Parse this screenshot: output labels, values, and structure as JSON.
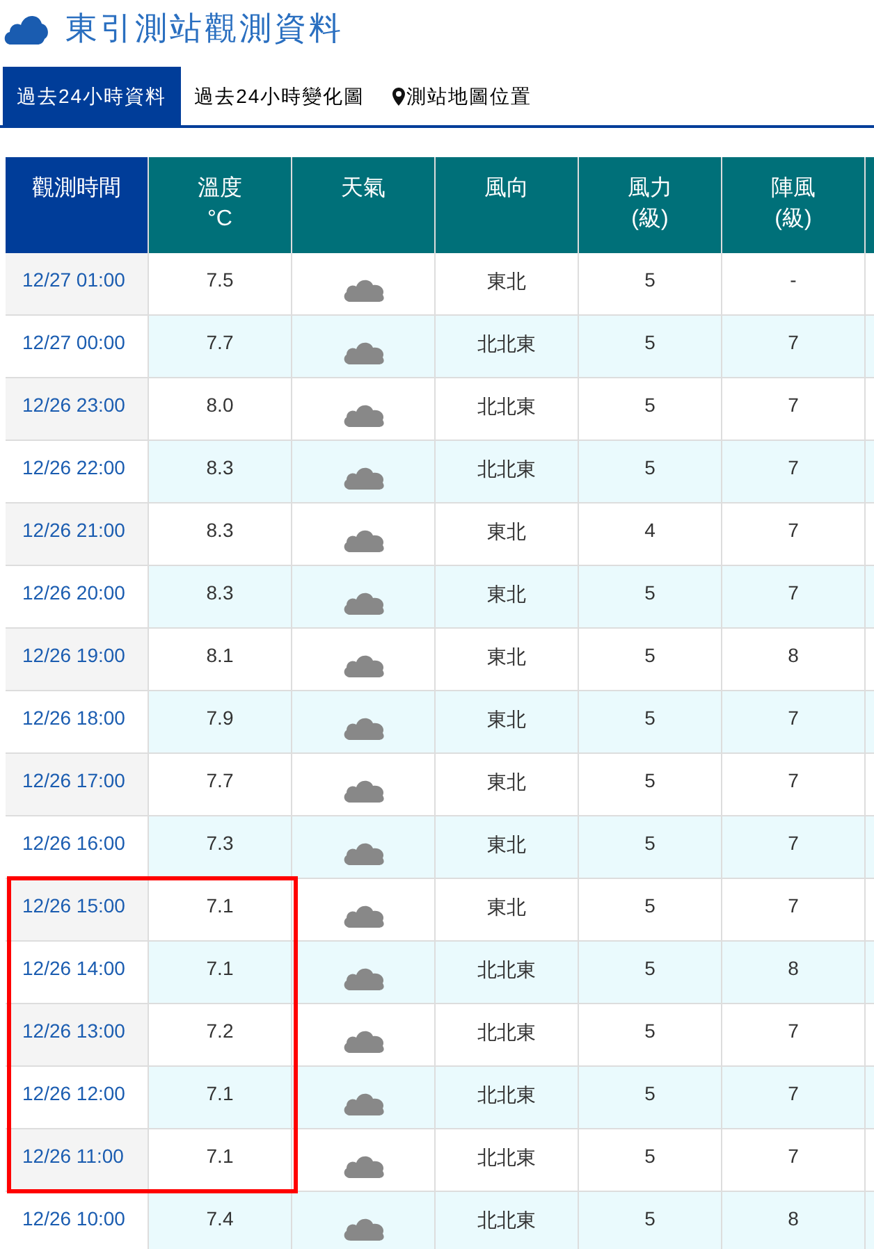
{
  "title": "東引測站觀測資料",
  "tabs": [
    {
      "label": "過去24小時資料",
      "selected": true,
      "kind": "plain"
    },
    {
      "label": "過去24小時變化圖",
      "selected": false,
      "kind": "plain"
    },
    {
      "label": "測站地圖位置",
      "selected": false,
      "kind": "map"
    }
  ],
  "table": {
    "columns": [
      [
        "觀測時間"
      ],
      [
        "溫度",
        "°C"
      ],
      [
        "天氣"
      ],
      [
        "風向"
      ],
      [
        "風力",
        "(級)"
      ],
      [
        "陣風",
        "(級)"
      ]
    ],
    "rows": [
      {
        "time": "12/27 01:00",
        "temp": "7.5",
        "dir": "東北",
        "force": "5",
        "gust": "-",
        "highlighted": false
      },
      {
        "time": "12/27 00:00",
        "temp": "7.7",
        "dir": "北北東",
        "force": "5",
        "gust": "7",
        "highlighted": false
      },
      {
        "time": "12/26 23:00",
        "temp": "8.0",
        "dir": "北北東",
        "force": "5",
        "gust": "7",
        "highlighted": false
      },
      {
        "time": "12/26 22:00",
        "temp": "8.3",
        "dir": "北北東",
        "force": "5",
        "gust": "7",
        "highlighted": false
      },
      {
        "time": "12/26 21:00",
        "temp": "8.3",
        "dir": "東北",
        "force": "4",
        "gust": "7",
        "highlighted": false
      },
      {
        "time": "12/26 20:00",
        "temp": "8.3",
        "dir": "東北",
        "force": "5",
        "gust": "7",
        "highlighted": false
      },
      {
        "time": "12/26 19:00",
        "temp": "8.1",
        "dir": "東北",
        "force": "5",
        "gust": "8",
        "highlighted": false
      },
      {
        "time": "12/26 18:00",
        "temp": "7.9",
        "dir": "東北",
        "force": "5",
        "gust": "7",
        "highlighted": false
      },
      {
        "time": "12/26 17:00",
        "temp": "7.7",
        "dir": "東北",
        "force": "5",
        "gust": "7",
        "highlighted": false
      },
      {
        "time": "12/26 16:00",
        "temp": "7.3",
        "dir": "東北",
        "force": "5",
        "gust": "7",
        "highlighted": false
      },
      {
        "time": "12/26 15:00",
        "temp": "7.1",
        "dir": "東北",
        "force": "5",
        "gust": "7",
        "highlighted": true
      },
      {
        "time": "12/26 14:00",
        "temp": "7.1",
        "dir": "北北東",
        "force": "5",
        "gust": "8",
        "highlighted": true
      },
      {
        "time": "12/26 13:00",
        "temp": "7.2",
        "dir": "北北東",
        "force": "5",
        "gust": "7",
        "highlighted": true
      },
      {
        "time": "12/26 12:00",
        "temp": "7.1",
        "dir": "北北東",
        "force": "5",
        "gust": "7",
        "highlighted": true
      },
      {
        "time": "12/26 11:00",
        "temp": "7.1",
        "dir": "北北東",
        "force": "5",
        "gust": "7",
        "highlighted": true
      },
      {
        "time": "12/26 10:00",
        "temp": "7.4",
        "dir": "北北東",
        "force": "5",
        "gust": "8",
        "highlighted": false
      }
    ]
  }
}
